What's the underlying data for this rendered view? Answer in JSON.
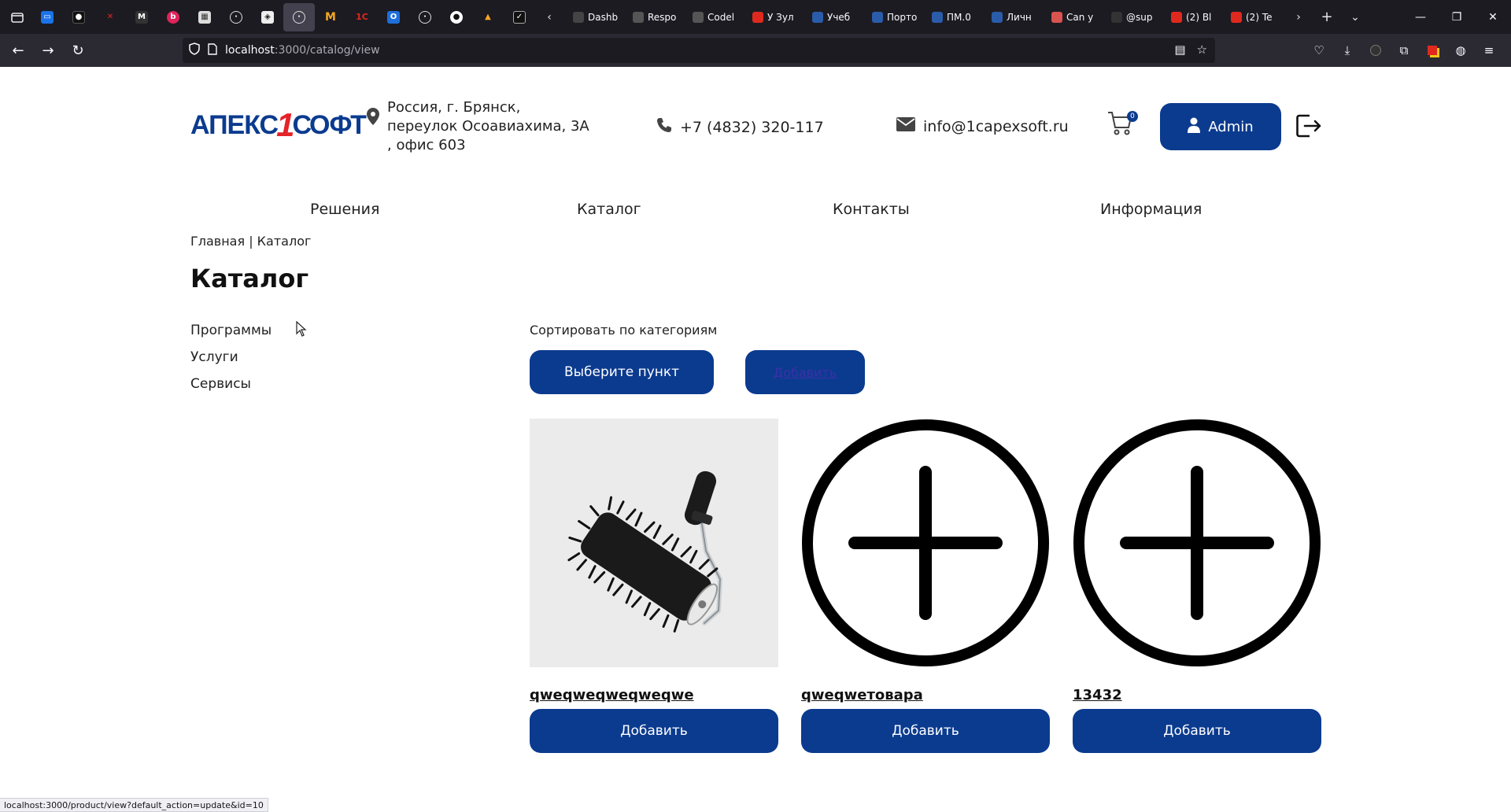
{
  "browser": {
    "tabs": [
      {
        "title": "Dashb",
        "color": "#444"
      },
      {
        "title": "Respo",
        "color": "#555"
      },
      {
        "title": "Codel",
        "color": "#555"
      },
      {
        "title": "У Зул",
        "color": "#e0291e"
      },
      {
        "title": "Учеб",
        "color": "#2a5caa"
      },
      {
        "title": "Порто",
        "color": "#2a5caa"
      },
      {
        "title": "ПМ.0",
        "color": "#2a5caa"
      },
      {
        "title": "Личн",
        "color": "#2a5caa"
      },
      {
        "title": "Can y",
        "color": "#d9534f"
      },
      {
        "title": "@sup",
        "color": "#333"
      },
      {
        "title": "(2) Bl",
        "color": "#e0291e"
      },
      {
        "title": "(2) Te",
        "color": "#e0291e"
      }
    ],
    "url_host": "localhost",
    "url_path": ":3000/catalog/view",
    "status_url": "localhost:3000/product/view?default_action=update&id=10"
  },
  "header": {
    "address_lines": [
      "Россия, г. Брянск,",
      "переулок Осоавиахима, 3А",
      ", офис 603"
    ],
    "phone": "+7 (4832) 320-117",
    "email": "info@1capexsoft.ru",
    "cart_count": "0",
    "admin_label": "Admin"
  },
  "menu": {
    "solutions": "Решения",
    "catalog": "Каталог",
    "contacts": "Контакты",
    "info": "Информация"
  },
  "breadcrumb": "Главная | Каталог",
  "page_title": "Каталог",
  "sidebar": [
    "Программы",
    "Услуги",
    "Сервисы"
  ],
  "sort": {
    "label": "Сортировать по категориям",
    "select_label": "Выберите пункт",
    "add_label": "Добавить"
  },
  "products": [
    {
      "name": "qweqweqweqweqwe",
      "button": "Добавить",
      "image": "paint-roller"
    },
    {
      "name": "qweqwетовара",
      "button": "Добавить",
      "image": "plus-circle-icon"
    },
    {
      "name": "13432",
      "button": "Добавить",
      "image": "plus-circle-icon"
    }
  ],
  "colors": {
    "brand_blue": "#0b3b8f",
    "brand_red": "#e4232a"
  }
}
